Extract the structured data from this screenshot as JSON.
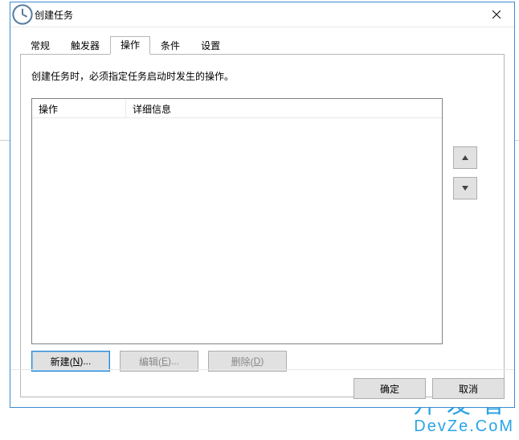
{
  "title": "创建任务",
  "tabs": [
    {
      "label": "常规"
    },
    {
      "label": "触发器"
    },
    {
      "label": "操作",
      "active": true
    },
    {
      "label": "条件"
    },
    {
      "label": "设置"
    }
  ],
  "panel": {
    "hint": "创建任务时，必须指定任务启动时发生的操作。",
    "columns": [
      "操作",
      "详细信息"
    ],
    "rows": [],
    "buttons": {
      "new": {
        "pre": "新建(",
        "key": "N",
        "post": ")..."
      },
      "edit": {
        "pre": "编辑(",
        "key": "E",
        "post": ")..."
      },
      "del": {
        "pre": "删除(",
        "key": "D",
        "post": ")"
      }
    }
  },
  "footer": {
    "ok": "确定",
    "cancel": "取消"
  },
  "watermark": "开发者 DevZe.CoM"
}
